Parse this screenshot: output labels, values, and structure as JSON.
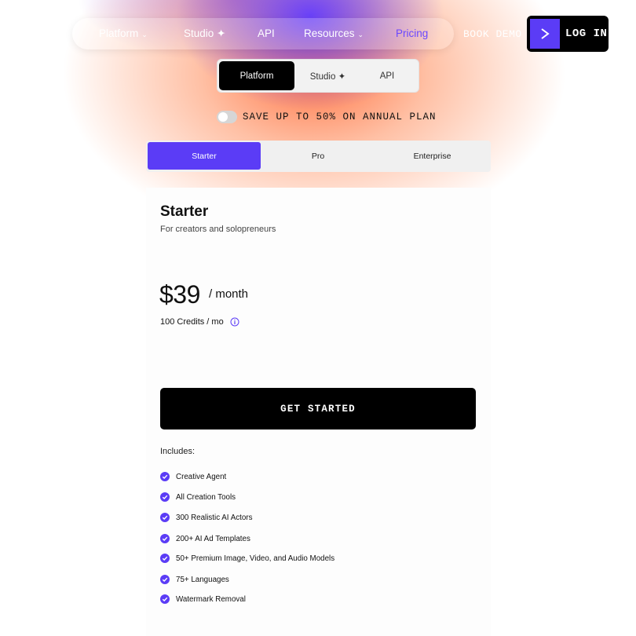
{
  "colors": {
    "accent": "#5b3cf6",
    "nav_active": "#6a47ff",
    "dark": "#000000"
  },
  "nav": {
    "items": [
      {
        "label": "Platform",
        "has_caret": true
      },
      {
        "label": "Studio ✦",
        "has_caret": false
      },
      {
        "label": "API",
        "has_caret": false
      },
      {
        "label": "Resources",
        "has_caret": true
      },
      {
        "label": "Pricing",
        "has_caret": false,
        "active": true
      }
    ],
    "caret": "⌄",
    "book_demo": "BOOK DEMO",
    "login": "LOG IN"
  },
  "product_tabs": {
    "items": [
      "Platform",
      "Studio ✦",
      "API"
    ],
    "selected": "Platform"
  },
  "billing": {
    "annual_toggle_on": false,
    "label": "SAVE UP TO 50% ON ANNUAL PLAN"
  },
  "tiers": {
    "items": [
      "Starter",
      "Pro",
      "Enterprise"
    ],
    "selected": "Starter"
  },
  "plan": {
    "name": "Starter",
    "subtitle": "For creators and solopreneurs",
    "price": "$39",
    "period": "/ month",
    "credits": "100 Credits / mo",
    "cta": "GET STARTED",
    "includes_label": "Includes:",
    "features": [
      "Creative Agent",
      "All Creation Tools",
      "300 Realistic AI Actors",
      "200+ AI Ad Templates",
      "50+ Premium Image, Video, and Audio Models",
      "75+ Languages",
      "Watermark Removal"
    ]
  },
  "icons": [
    "logo-icon",
    "chevron-right-icon",
    "info-icon",
    "check-circle-icon"
  ]
}
